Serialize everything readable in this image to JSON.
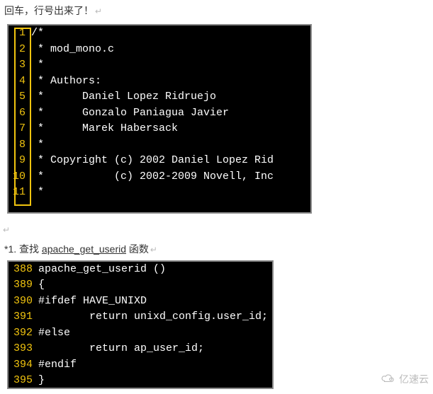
{
  "top_text": "回车，行号出来了！",
  "block1": {
    "lines": [
      {
        "n": "1",
        "t": "/*"
      },
      {
        "n": "2",
        "t": " * mod_mono.c"
      },
      {
        "n": "3",
        "t": " *"
      },
      {
        "n": "4",
        "t": " * Authors:"
      },
      {
        "n": "5",
        "t": " *      Daniel Lopez Ridruejo"
      },
      {
        "n": "6",
        "t": " *      Gonzalo Paniagua Javier"
      },
      {
        "n": "7",
        "t": " *      Marek Habersack"
      },
      {
        "n": "8",
        "t": " *"
      },
      {
        "n": "9",
        "t": " * Copyright (c) 2002 Daniel Lopez Rid"
      },
      {
        "n": "10",
        "t": " *           (c) 2002-2009 Novell, Inc"
      },
      {
        "n": "11",
        "t": " *"
      }
    ]
  },
  "mid_prefix": "*1. 查找 ",
  "mid_func": "apache_get_userid",
  "mid_suffix": " 函数",
  "block2": {
    "lines": [
      {
        "n": "388",
        "t": "apache_get_userid ()"
      },
      {
        "n": "389",
        "t": "{"
      },
      {
        "n": "390",
        "t": "#ifdef HAVE_UNIXD"
      },
      {
        "n": "391",
        "t": "        return unixd_config.user_id;"
      },
      {
        "n": "392",
        "t": "#else"
      },
      {
        "n": "393",
        "t": "        return ap_user_id;"
      },
      {
        "n": "394",
        "t": "#endif"
      },
      {
        "n": "395",
        "t": "}"
      }
    ]
  },
  "watermark": "亿速云",
  "cursor_glyph": "↵"
}
